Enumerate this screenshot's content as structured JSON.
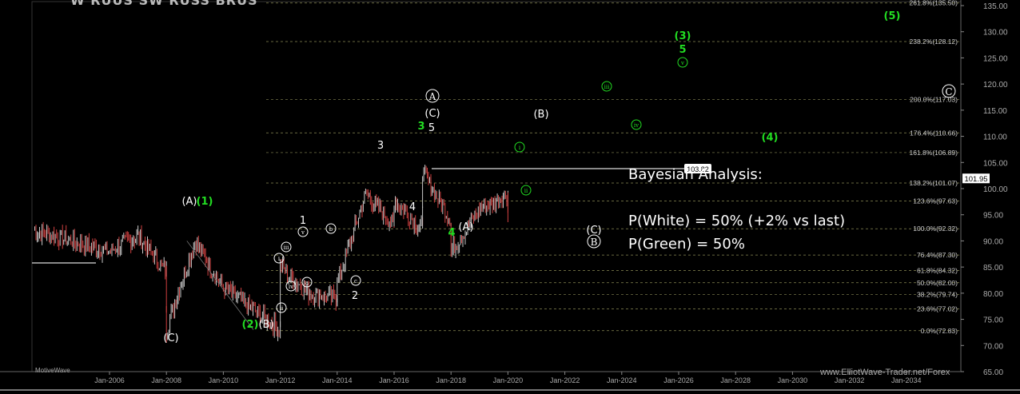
{
  "header": {
    "title_fragment": "W RUUS SW RUSS BRUS"
  },
  "footer": {
    "app_label": "MotiveWave",
    "watermark": "www.ElliotWave-Trader.net/Forex"
  },
  "analysis": {
    "heading": "Bayesian Analysis:",
    "white": "P(White) = 50% (+2% vs last)",
    "green": "P(Green) = 50%"
  },
  "colors": {
    "white_count": "#ffffff",
    "green_count": "#22dd22",
    "price": "#c8c8c8",
    "down": "#d04040",
    "grid": "#5a5a3a",
    "fib": "#8a8a55"
  },
  "chart_data": {
    "type": "line",
    "x": [
      "Jan-2005",
      "Jan-2006",
      "Jan-2007",
      "Jan-2008",
      "Jan-2008",
      "Jan-2009",
      "Jan-2010",
      "Jan-2011",
      "Jan-2012",
      "Jan-2012",
      "Jan-2013",
      "Jan-2014",
      "Jan-2014",
      "Jan-2015",
      "Jan-2016",
      "Jan-2016",
      "Jan-2017",
      "Jan-2017",
      "Jan-2018",
      "Jan-2018",
      "Jan-2019",
      "Jan-2020",
      "Jan-2020"
    ],
    "y": [
      92,
      88,
      91,
      84,
      73,
      90,
      81,
      77,
      73,
      85,
      80,
      79,
      82,
      99,
      93,
      98,
      92,
      103,
      94,
      88,
      96,
      99,
      94
    ],
    "ylim": [
      65,
      135
    ],
    "yticks": [
      65,
      70,
      75,
      80,
      85,
      90,
      95,
      100,
      105,
      110,
      115,
      120,
      125,
      130,
      135
    ],
    "xticks": [
      "Jan-2006",
      "Jan-2008",
      "Jan-2010",
      "Jan-2012",
      "Jan-2014",
      "Jan-2016",
      "Jan-2018",
      "Jan-2020",
      "Jan-2022",
      "Jan-2024",
      "Jan-2026",
      "Jan-2028",
      "Jan-2030",
      "Jan-2032",
      "Jan-2034"
    ],
    "fib_levels": [
      {
        "label": "261.8%(135.50)",
        "value": 135.5
      },
      {
        "label": "238.2%(128.12)",
        "value": 128.12
      },
      {
        "label": "200.0%(117.03)",
        "value": 117.03
      },
      {
        "label": "176.4%(110.66)",
        "value": 110.66
      },
      {
        "label": "161.8%(106.89)",
        "value": 106.89
      },
      {
        "label": "138.2%(101.07)",
        "value": 101.07
      },
      {
        "label": "123.6%(97.63)",
        "value": 97.63
      },
      {
        "label": "100.0%(92.32)",
        "value": 92.32
      },
      {
        "label": "76.4%(87.30)",
        "value": 87.3
      },
      {
        "label": "61.8%(84.32)",
        "value": 84.32
      },
      {
        "label": "50.0%(82.00)",
        "value": 82.0
      },
      {
        "label": "38.2%(79.74)",
        "value": 79.74
      },
      {
        "label": "23.6%(77.02)",
        "value": 77.02
      },
      {
        "label": "0.0%(72.83)",
        "value": 72.83
      }
    ],
    "last_price": "101.95",
    "resistance": {
      "label": "103.82",
      "value": 103.82
    },
    "annotations": [
      {
        "text": "(A)",
        "x": "Jan-2009",
        "y": 91,
        "color": "white"
      },
      {
        "text": "(1)",
        "x": "Jan-2009",
        "y": 91,
        "color": "green"
      },
      {
        "text": "(C)",
        "x": "Jan-2008",
        "y": 70,
        "color": "white"
      },
      {
        "text": "(2)",
        "x": "Jan-2011",
        "y": 72,
        "color": "green"
      },
      {
        "text": "(B)",
        "x": "Jan-2011",
        "y": 72,
        "color": "white"
      },
      {
        "text": "1",
        "x": "Jan-2012",
        "y": 88,
        "color": "white"
      },
      {
        "text": "2",
        "x": "Jan-2014",
        "y": 75,
        "color": "white"
      },
      {
        "text": "3",
        "x": "Jan-2015",
        "y": 102,
        "color": "white"
      },
      {
        "text": "4",
        "x": "Jan-2016",
        "y": 90,
        "color": "white"
      },
      {
        "text": "3",
        "x": "Jan-2017",
        "y": 104,
        "color": "green"
      },
      {
        "text": "5",
        "x": "Jan-2017",
        "y": 104,
        "color": "white"
      },
      {
        "text": "(C)",
        "x": "Jan-2017",
        "y": 106,
        "color": "white"
      },
      {
        "text": "A",
        "x": "Jan-2017",
        "y": 108,
        "color": "white",
        "circled": true
      },
      {
        "text": "4",
        "x": "Jan-2018",
        "y": 85,
        "color": "green"
      },
      {
        "text": "(A)",
        "x": "Jan-2018",
        "y": 86,
        "color": "white"
      },
      {
        "text": "(B)",
        "x": "Jan-2020",
        "y": 106,
        "color": "white"
      },
      {
        "text": "(C)",
        "x": "Jan-2022",
        "y": 85,
        "color": "white"
      },
      {
        "text": "B",
        "x": "Jan-2022",
        "y": 83,
        "color": "white",
        "circled": true
      },
      {
        "text": "C",
        "x": "Jan-2034",
        "y": 111,
        "color": "white",
        "circled": true
      },
      {
        "text": "(3)",
        "x": "Jan-2026",
        "y": 125,
        "color": "green"
      },
      {
        "text": "5",
        "x": "Jan-2026",
        "y": 123,
        "color": "green"
      },
      {
        "text": "v",
        "x": "Jan-2026",
        "y": 121,
        "color": "green",
        "circled": true
      },
      {
        "text": "iii",
        "x": "Jan-2023",
        "y": 114,
        "color": "green",
        "circled": true
      },
      {
        "text": "iv",
        "x": "Jan-2024",
        "y": 105,
        "color": "green",
        "circled": true
      },
      {
        "text": "(4)",
        "x": "Jan-2028",
        "y": 103,
        "color": "green"
      },
      {
        "text": "(5)",
        "x": "Jan-2032",
        "y": 134,
        "color": "green"
      },
      {
        "text": "i",
        "x": "Jan-2020",
        "y": 101,
        "color": "green",
        "circled": true
      },
      {
        "text": "ii",
        "x": "Jan-2020",
        "y": 92,
        "color": "green",
        "circled": true
      },
      {
        "text": "i",
        "x": "Jan-2012",
        "y": 81,
        "color": "white",
        "circled": true
      },
      {
        "text": "ii",
        "x": "Jan-2012",
        "y": 73,
        "color": "white",
        "circled": true
      },
      {
        "text": "iii",
        "x": "Jan-2012",
        "y": 83,
        "color": "white",
        "circled": true
      },
      {
        "text": "iv",
        "x": "Jan-2012",
        "y": 77,
        "color": "white",
        "circled": true
      },
      {
        "text": "v",
        "x": "Jan-2012",
        "y": 86,
        "color": "white",
        "circled": true
      },
      {
        "text": "a",
        "x": "Jan-2013",
        "y": 77,
        "color": "white",
        "circled": true
      },
      {
        "text": "b",
        "x": "Jan-2013",
        "y": 87,
        "color": "white",
        "circled": true
      },
      {
        "text": "c",
        "x": "Jan-2014",
        "y": 77,
        "color": "white",
        "circled": true
      }
    ]
  }
}
